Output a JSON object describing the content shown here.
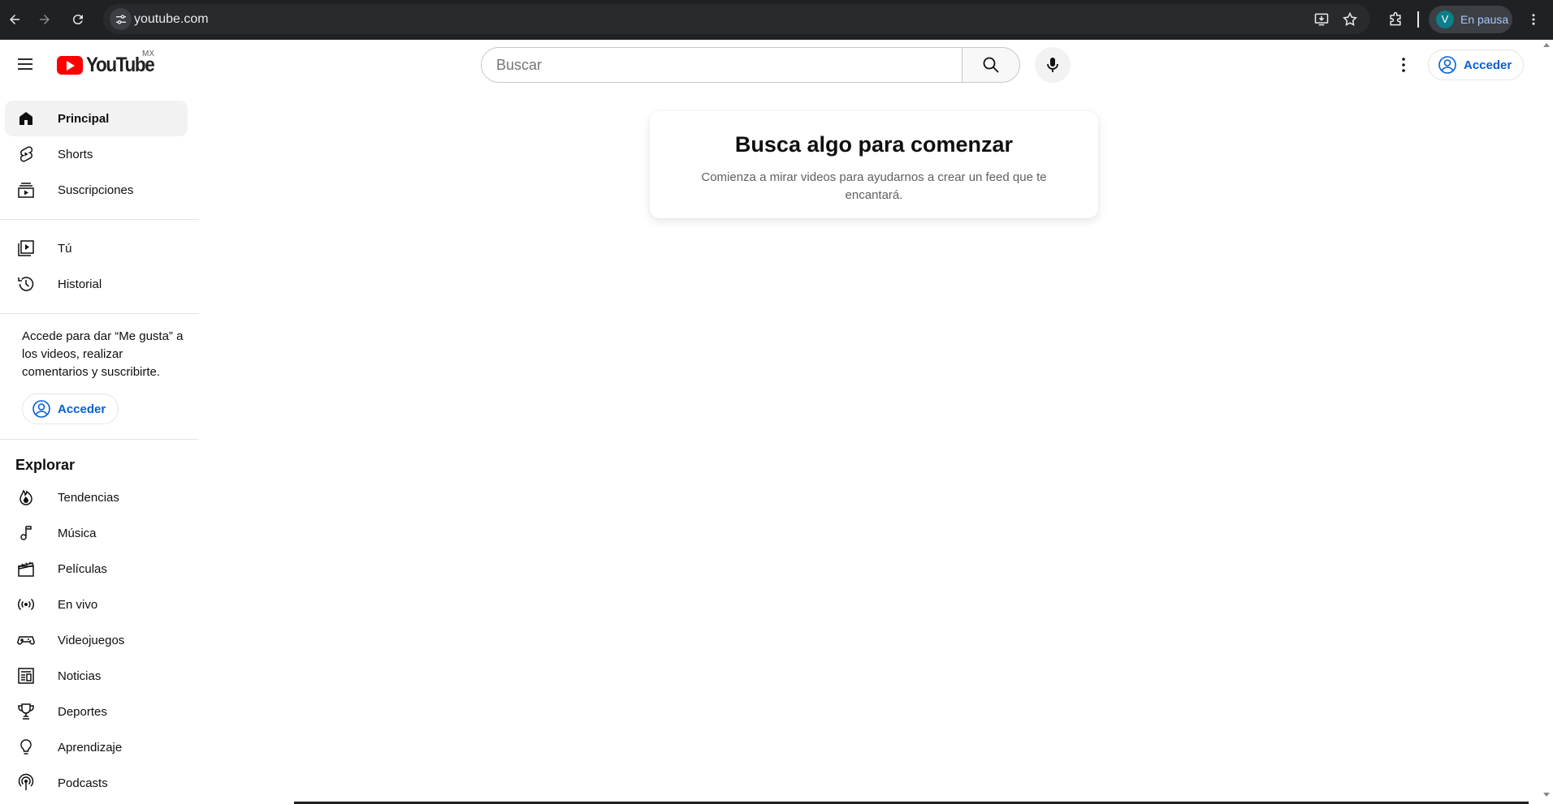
{
  "browser": {
    "url": "youtube.com",
    "profile_initial": "V",
    "profile_status": "En pausa"
  },
  "masthead": {
    "logo_text": "YouTube",
    "region": "MX",
    "search_placeholder": "Buscar",
    "signin_label": "Acceder"
  },
  "sidebar": {
    "primary": [
      {
        "label": "Principal",
        "icon": "home-icon",
        "active": true
      },
      {
        "label": "Shorts",
        "icon": "shorts-icon"
      },
      {
        "label": "Suscripciones",
        "icon": "subscriptions-icon"
      }
    ],
    "you": [
      {
        "label": "Tú",
        "icon": "you-icon"
      },
      {
        "label": "Historial",
        "icon": "history-icon"
      }
    ],
    "signin_prompt": "Accede para dar “Me gusta” a los videos, realizar comentarios y suscribirte.",
    "signin_label": "Acceder",
    "explore_title": "Explorar",
    "explore": [
      {
        "label": "Tendencias",
        "icon": "trending-icon"
      },
      {
        "label": "Música",
        "icon": "music-icon"
      },
      {
        "label": "Películas",
        "icon": "movies-icon"
      },
      {
        "label": "En vivo",
        "icon": "live-icon"
      },
      {
        "label": "Videojuegos",
        "icon": "gaming-icon"
      },
      {
        "label": "Noticias",
        "icon": "news-icon"
      },
      {
        "label": "Deportes",
        "icon": "sports-icon"
      },
      {
        "label": "Aprendizaje",
        "icon": "learning-icon"
      },
      {
        "label": "Podcasts",
        "icon": "podcasts-icon"
      }
    ]
  },
  "main": {
    "card_title": "Busca algo para comenzar",
    "card_description": "Comienza a mirar videos para ayudarnos a crear un feed que te encantará."
  },
  "colors": {
    "accent_link": "#065fd4",
    "logo_red": "#ff0000",
    "chrome_dark": "#202124"
  }
}
